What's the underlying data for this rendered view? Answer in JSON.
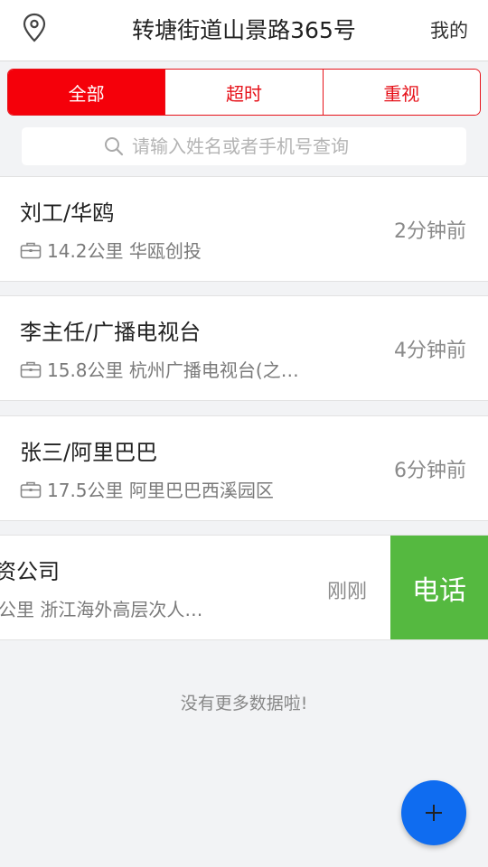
{
  "header": {
    "title": "转塘街道山景路365号",
    "mine_label": "我的"
  },
  "filter": {
    "tabs": [
      {
        "label": "全部",
        "active": true
      },
      {
        "label": "超时",
        "active": false
      },
      {
        "label": "重视",
        "active": false
      }
    ],
    "search_placeholder": "请输入姓名或者手机号查询"
  },
  "list": {
    "items": [
      {
        "name": "刘工/华鸥",
        "detail": "14.2公里 华瓯创投",
        "time": "2分钟前"
      },
      {
        "name": "李主任/广播电视台",
        "detail": "15.8公里 杭州广播电视台(之…",
        "time": "4分钟前"
      },
      {
        "name": "张三/阿里巴巴",
        "detail": "17.5公里 阿里巴巴西溪园区",
        "time": "6分钟前"
      },
      {
        "name": "资公司",
        "detail": "公里 浙江海外高层次人…",
        "time": "刚刚",
        "action_label": "电话"
      }
    ],
    "end_text": "没有更多数据啦!"
  },
  "icons": {
    "location": "location-pin-icon",
    "search": "search-icon",
    "briefcase": "briefcase-icon",
    "add": "plus-icon"
  },
  "colors": {
    "accent_red": "#f5000a",
    "call_green": "#55b940",
    "fab_blue": "#0f6cf0"
  }
}
